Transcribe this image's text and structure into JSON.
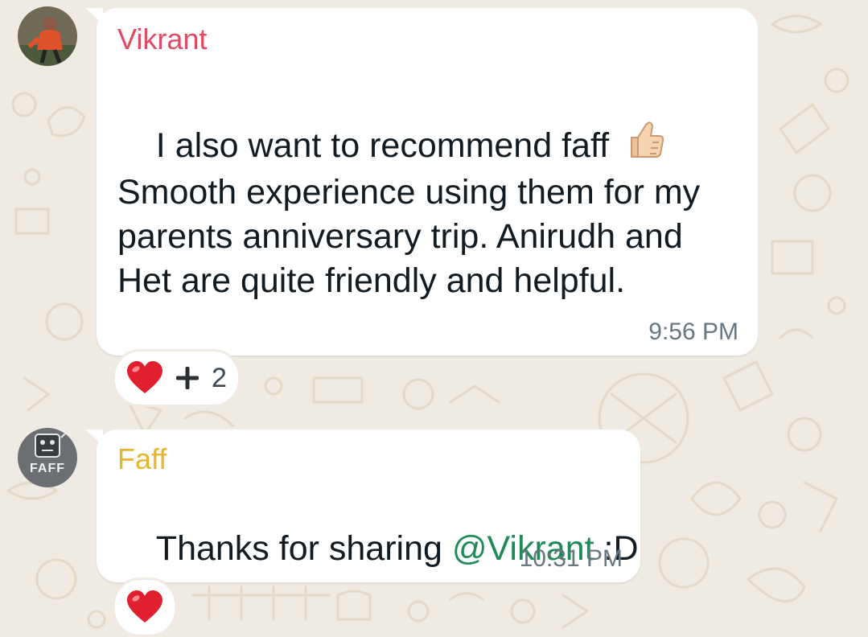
{
  "colors": {
    "vikrant_name": "#e04a63",
    "faff_name": "#e8b62c",
    "mention": "#1f8a57",
    "time": "#667781",
    "wallpaper": "#efeae2"
  },
  "messages": [
    {
      "sender": "Vikrant",
      "avatar_icon": "user-photo-avatar",
      "line1": "I also want to recommend faff",
      "emoji_icon": "thumbs-up-icon",
      "body": "Smooth experience using them for my\nparents anniversary trip. Anirudh and\nHet are quite friendly and helpful.",
      "time": "9:56 PM",
      "reactions": {
        "icon": "heart-icon",
        "more_icon": "plus-icon",
        "count": "2"
      }
    },
    {
      "sender": "Faff",
      "avatar_icon": "faff-logo-avatar",
      "avatar_logo_text": "FAFF",
      "text_before": "Thanks for sharing ",
      "mention": "@Vikrant",
      "text_after": " :D",
      "time": "10:31 PM",
      "reactions": {
        "icon": "heart-icon"
      }
    }
  ]
}
